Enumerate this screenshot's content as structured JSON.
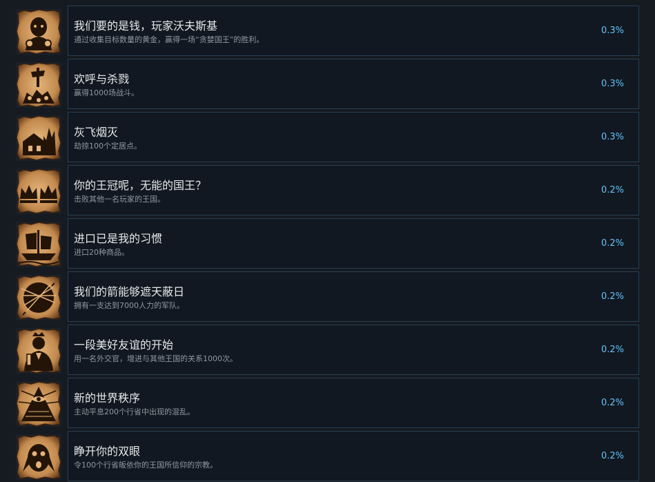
{
  "achievements": [
    {
      "title": "我们要的是钱，玩家沃夫斯基",
      "desc": "通过收集目标数量的黄金，赢得一场“贪婪国王”的胜利。",
      "percent": "0.3%",
      "icon": "money-man-icon"
    },
    {
      "title": "欢呼与杀戮",
      "desc": "赢得1000场战斗。",
      "percent": "0.3%",
      "icon": "skull-pile-icon"
    },
    {
      "title": "灰飞烟灭",
      "desc": "劫掠100个定居点。",
      "percent": "0.3%",
      "icon": "burning-house-icon"
    },
    {
      "title": "你的王冠呢，无能的国王？",
      "desc": "击败其他一名玩家的王国。",
      "percent": "0.2%",
      "icon": "crowns-icon"
    },
    {
      "title": "进口已是我的习惯",
      "desc": "进口20种商品。",
      "percent": "0.2%",
      "icon": "ship-icon"
    },
    {
      "title": "我们的箭能够遮天蔽日",
      "desc": "拥有一支达到7000人力的军队。",
      "percent": "0.2%",
      "icon": "arrows-sun-icon"
    },
    {
      "title": "一段美好友谊的开始",
      "desc": "用一名外交官，增进与其他王国的关系1000次。",
      "percent": "0.2%",
      "icon": "diplomat-icon"
    },
    {
      "title": "新的世界秩序",
      "desc": "主动平息200个行省中出现的混乱。",
      "percent": "0.2%",
      "icon": "pyramid-eye-icon"
    },
    {
      "title": "睁开你的双眼",
      "desc": "令100个行省皈依你的王国所信仰的宗教。",
      "percent": "0.2%",
      "icon": "shocked-face-icon"
    }
  ],
  "colors": {
    "background": "#161a21",
    "card": "#111821",
    "card_border": "#2a3f52",
    "percent": "#67c1f5",
    "parchment": "#c9935a",
    "ink": "#241408"
  }
}
